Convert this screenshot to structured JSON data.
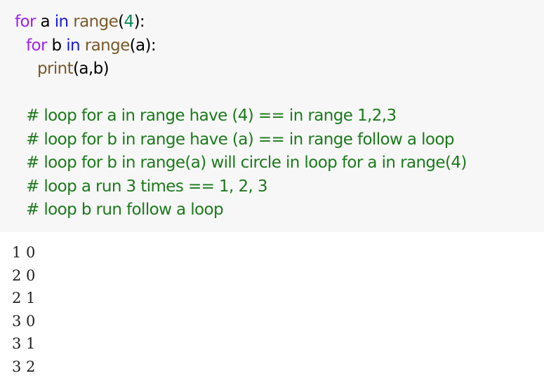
{
  "code": {
    "line1": {
      "kw_for": "for",
      "var": " a ",
      "kw_in": "in",
      "sp": " ",
      "fn": "range",
      "open": "(",
      "num": "4",
      "close": "):"
    },
    "line2": {
      "kw_for": "for",
      "var": " b ",
      "kw_in": "in",
      "sp": " ",
      "fn": "range",
      "open": "(",
      "arg": "a",
      "close": "):"
    },
    "line3": {
      "fn": "print",
      "args": "(a,b)"
    },
    "comments": [
      "# loop for a in range have (4) == in range 1,2,3",
      "# loop for b in range have (a) == in range follow a loop",
      "# loop for b in range(a) will circle in loop for a in range(4)",
      "# loop a run 3 times == 1, 2, 3",
      "# loop b run follow a loop"
    ]
  },
  "output": [
    "1 0",
    "2 0",
    "2 1",
    "3 0",
    "3 1",
    "3 2"
  ],
  "colors": {
    "keyword_for": "#a020f0",
    "keyword_in": "#1a1ad9",
    "builtin": "#7a5a2a",
    "number": "#0a8a5a",
    "comment": "#1c7a1c",
    "code_background": "#f7f7f7",
    "output_text": "#222222"
  }
}
